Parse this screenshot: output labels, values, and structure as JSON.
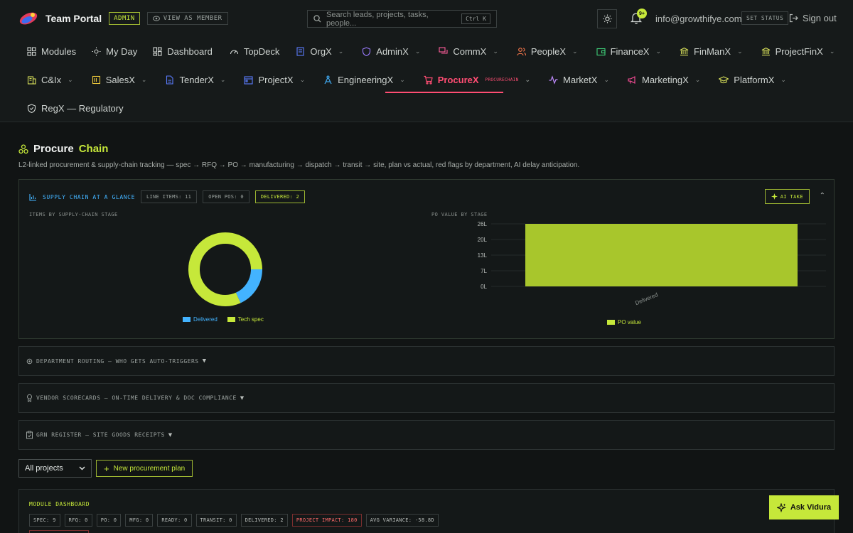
{
  "header": {
    "brand_name": "Team Portal",
    "role_tag": "ADMIN",
    "view_as_label": "VIEW AS MEMBER",
    "search_placeholder": "Search leads, projects, tasks, people...",
    "search_shortcut": "Ctrl K",
    "notification_badge": "9+",
    "email": "info@growthifye.com",
    "set_status_label": "SET STATUS",
    "signout_label": "Sign out"
  },
  "nav": {
    "row1": [
      {
        "label": "Modules",
        "icon": "grid-icon"
      },
      {
        "label": "My Day",
        "icon": "sun-icon"
      },
      {
        "label": "Dashboard",
        "icon": "dashboard-icon"
      },
      {
        "label": "TopDeck",
        "icon": "gauge-icon"
      },
      {
        "label": "OrgX",
        "icon": "org-icon"
      },
      {
        "label": "AdminX",
        "icon": "shield-icon"
      },
      {
        "label": "CommX",
        "icon": "chat-icon"
      },
      {
        "label": "PeopleX",
        "icon": "people-icon"
      },
      {
        "label": "FinanceX",
        "icon": "wallet-icon"
      },
      {
        "label": "FinManX",
        "icon": "bank-icon"
      },
      {
        "label": "ProjectFinX",
        "icon": "bank-icon"
      }
    ],
    "row2": [
      {
        "label": "C&Ix",
        "icon": "building-icon"
      },
      {
        "label": "SalesX",
        "icon": "ledger-icon"
      },
      {
        "label": "TenderX",
        "icon": "document-icon"
      },
      {
        "label": "ProjectX",
        "icon": "calendar-icon"
      },
      {
        "label": "EngineeringX",
        "icon": "compass-icon"
      },
      {
        "label": "ProcureX",
        "icon": "cart-icon",
        "sub": "PROCURECHAIN"
      },
      {
        "label": "MarketX",
        "icon": "pulse-icon"
      },
      {
        "label": "MarketingX",
        "icon": "megaphone-icon"
      },
      {
        "label": "PlatformX",
        "icon": "graduation-icon"
      }
    ],
    "row3": [
      {
        "label": "RegX — Regulatory",
        "icon": "shield-check-icon"
      }
    ]
  },
  "page": {
    "title_part1": "Procure",
    "title_part2": "Chain",
    "description": "L2-linked procurement & supply-chain tracking — spec → RFQ → PO → manufacturing → dispatch → transit → site, plan vs actual, red flags by department, AI delay anticipation."
  },
  "glance": {
    "title": "SUPPLY CHAIN AT A GLANCE",
    "chips": [
      "LINE ITEMS: 11",
      "OPEN POS: 0",
      "DELIVERED: 2"
    ],
    "ai_take_label": "AI TAKE",
    "donut_title": "ITEMS BY SUPPLY-CHAIN STAGE",
    "bar_title": "PO VALUE BY STAGE"
  },
  "chart_data": [
    {
      "type": "pie",
      "title": "ITEMS BY SUPPLY-CHAIN STAGE",
      "categories": [
        "Delivered",
        "Tech spec"
      ],
      "values": [
        2,
        9
      ],
      "colors": [
        "#43b3ff",
        "#c6e83a"
      ],
      "legend": "bottom"
    },
    {
      "type": "bar",
      "title": "PO VALUE BY STAGE",
      "categories": [
        "Delivered"
      ],
      "series": [
        {
          "name": "PO value",
          "values": [
            26
          ]
        }
      ],
      "ticks": [
        "0L",
        "7L",
        "13L",
        "20L",
        "26L"
      ],
      "ylim": [
        0,
        26
      ],
      "color": "#a8c62c",
      "legend": "bottom"
    }
  ],
  "sections": [
    {
      "label": "DEPARTMENT ROUTING — WHO GETS AUTO-TRIGGERS",
      "icon": "gear-icon"
    },
    {
      "label": "VENDOR SCORECARDS — ON-TIME DELIVERY & DOC COMPLIANCE",
      "icon": "award-icon"
    },
    {
      "label": "GRN REGISTER — SITE GOODS RECEIPTS",
      "icon": "clipboard-icon"
    }
  ],
  "controls": {
    "project_select": "All projects",
    "new_plan_label": "New procurement plan"
  },
  "module": {
    "title": "MODULE DASHBOARD",
    "stats": [
      "SPEC: 9",
      "RFQ: 0",
      "PO: 0",
      "MFG: 0",
      "READY: 0",
      "TRANSIT: 0",
      "DELIVERED: 2",
      "PROJECT IMPACT: 180",
      "AVG VARIANCE: -58.8D"
    ]
  },
  "ask_label": "Ask Vidura"
}
